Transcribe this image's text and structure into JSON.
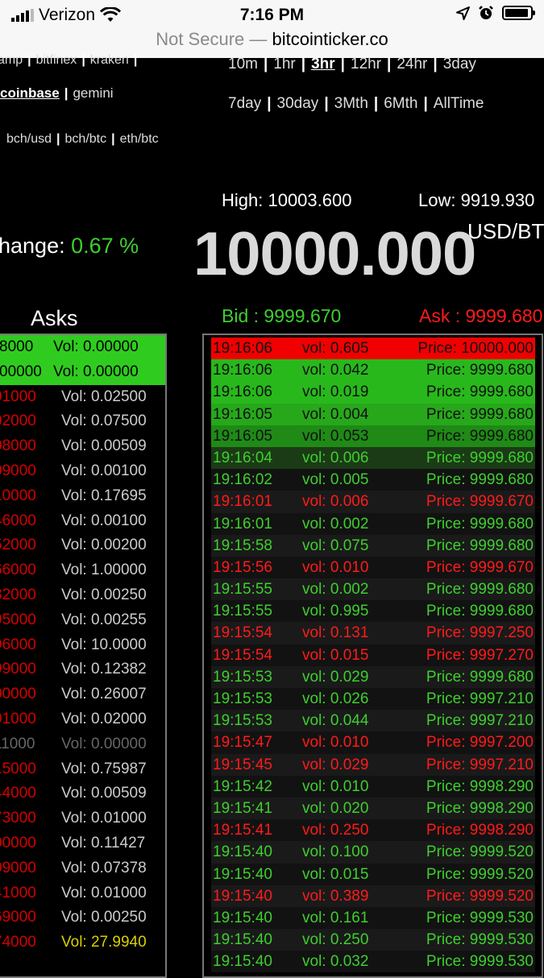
{
  "statusbar": {
    "carrier": "Verizon",
    "time": "7:16 PM"
  },
  "addressbar": {
    "security": "Not Secure —",
    "domain": "bitcointicker.co"
  },
  "exchanges": {
    "row1": [
      "amp",
      "bitfinex",
      "kraken"
    ],
    "row2": [
      "coinbase",
      "gemini"
    ],
    "selected": "coinbase"
  },
  "pairs": [
    "bch/usd",
    "bch/btc",
    "eth/btc"
  ],
  "ranges": {
    "row1": [
      "10m",
      "1hr",
      "3hr",
      "12hr",
      "24hr",
      "3day"
    ],
    "row2": [
      "7day",
      "30day",
      "3Mth",
      "6Mth",
      "AllTime"
    ],
    "selected": "3hr"
  },
  "ticker": {
    "high": "High: 10003.600",
    "low": "Low: 9919.930",
    "change_label": "hange:",
    "change_value": "0.67 %",
    "price": "10000.000",
    "unit": "USD/BT",
    "bid": "Bid  : 9999.670",
    "ask": "Ask : 9999.680"
  },
  "asks": {
    "title": "Asks",
    "rows": [
      {
        "price": "8000",
        "vol": "Vol: 0.00000",
        "style": "hl"
      },
      {
        "price": "00000",
        "vol": "Vol: 0.00000",
        "style": "hl"
      },
      {
        "price": "01000",
        "vol": "Vol: 0.02500",
        "style": "n"
      },
      {
        "price": "02000",
        "vol": "Vol: 0.07500",
        "style": "n"
      },
      {
        "price": "08000",
        "vol": "Vol: 0.00509",
        "style": "n"
      },
      {
        "price": "09000",
        "vol": "Vol: 0.00100",
        "style": "n"
      },
      {
        "price": "10000",
        "vol": "Vol: 0.17695",
        "style": "n"
      },
      {
        "price": "46000",
        "vol": "Vol: 0.00100",
        "style": "n"
      },
      {
        "price": "52000",
        "vol": "Vol: 0.00200",
        "style": "n"
      },
      {
        "price": "66000",
        "vol": "Vol: 1.00000",
        "style": "n"
      },
      {
        "price": "82000",
        "vol": "Vol: 0.00250",
        "style": "n"
      },
      {
        "price": "95000",
        "vol": "Vol: 0.00255",
        "style": "n"
      },
      {
        "price": "96000",
        "vol": "Vol: 10.0000",
        "style": "n"
      },
      {
        "price": "99000",
        "vol": "Vol: 0.12382",
        "style": "n"
      },
      {
        "price": "00000",
        "vol": "Vol: 0.26007",
        "style": "n"
      },
      {
        "price": "01000",
        "vol": "Vol: 0.02000",
        "style": "n"
      },
      {
        "price": "11000",
        "vol": "Vol: 0.00000",
        "style": "dim"
      },
      {
        "price": "15000",
        "vol": "Vol: 0.75987",
        "style": "n"
      },
      {
        "price": "44000",
        "vol": "Vol: 0.00509",
        "style": "n"
      },
      {
        "price": "73000",
        "vol": "Vol: 0.01000",
        "style": "n"
      },
      {
        "price": "00000",
        "vol": "Vol: 0.11427",
        "style": "n"
      },
      {
        "price": "09000",
        "vol": "Vol: 0.07378",
        "style": "n"
      },
      {
        "price": "41000",
        "vol": "Vol: 0.01000",
        "style": "n"
      },
      {
        "price": "69000",
        "vol": "Vol: 0.00250",
        "style": "n"
      },
      {
        "price": "74000",
        "vol": "Vol: 27.9940",
        "style": "big"
      }
    ]
  },
  "trades": [
    {
      "time": "19:16:06",
      "vol": "vol: 0.605",
      "price": "Price: 10000.000",
      "side": "sell",
      "flash": "#f00000"
    },
    {
      "time": "19:16:06",
      "vol": "vol: 0.042",
      "price": "Price: 9999.680",
      "side": "buy",
      "flash": "#28b81c"
    },
    {
      "time": "19:16:06",
      "vol": "vol: 0.019",
      "price": "Price: 9999.680",
      "side": "buy",
      "flash": "#28b81c"
    },
    {
      "time": "19:16:05",
      "vol": "vol: 0.004",
      "price": "Price: 9999.680",
      "side": "buy",
      "flash": "#27a81b"
    },
    {
      "time": "19:16:05",
      "vol": "vol: 0.053",
      "price": "Price: 9999.680",
      "side": "buy",
      "flash": "#1f8a16"
    },
    {
      "time": "19:16:04",
      "vol": "vol: 0.006",
      "price": "Price: 9999.680",
      "side": "buy",
      "flash": "#1b3b16"
    },
    {
      "time": "19:16:02",
      "vol": "vol: 0.005",
      "price": "Price: 9999.680",
      "side": "buy",
      "flash": "#121212"
    },
    {
      "time": "19:16:01",
      "vol": "vol: 0.006",
      "price": "Price: 9999.670",
      "side": "sell",
      "flash": "#1a1a1a"
    },
    {
      "time": "19:16:01",
      "vol": "vol: 0.002",
      "price": "Price: 9999.680",
      "side": "buy",
      "flash": "#121212"
    },
    {
      "time": "19:15:58",
      "vol": "vol: 0.075",
      "price": "Price: 9999.680",
      "side": "buy",
      "flash": "#1a1a1a"
    },
    {
      "time": "19:15:56",
      "vol": "vol: 0.010",
      "price": "Price: 9999.670",
      "side": "sell",
      "flash": "#121212"
    },
    {
      "time": "19:15:55",
      "vol": "vol: 0.002",
      "price": "Price: 9999.680",
      "side": "buy",
      "flash": "#1a1a1a"
    },
    {
      "time": "19:15:55",
      "vol": "vol: 0.995",
      "price": "Price: 9999.680",
      "side": "buy",
      "flash": "#121212"
    },
    {
      "time": "19:15:54",
      "vol": "vol: 0.131",
      "price": "Price: 9997.250",
      "side": "sell",
      "flash": "#1a1a1a"
    },
    {
      "time": "19:15:54",
      "vol": "vol: 0.015",
      "price": "Price: 9997.270",
      "side": "sell",
      "flash": "#121212"
    },
    {
      "time": "19:15:53",
      "vol": "vol: 0.029",
      "price": "Price: 9999.680",
      "side": "buy",
      "flash": "#1a1a1a"
    },
    {
      "time": "19:15:53",
      "vol": "vol: 0.026",
      "price": "Price: 9997.210",
      "side": "buy",
      "flash": "#121212"
    },
    {
      "time": "19:15:53",
      "vol": "vol: 0.044",
      "price": "Price: 9997.210",
      "side": "buy",
      "flash": "#1a1a1a"
    },
    {
      "time": "19:15:47",
      "vol": "vol: 0.010",
      "price": "Price: 9997.200",
      "side": "sell",
      "flash": "#121212"
    },
    {
      "time": "19:15:45",
      "vol": "vol: 0.029",
      "price": "Price: 9997.210",
      "side": "sell",
      "flash": "#1a1a1a"
    },
    {
      "time": "19:15:42",
      "vol": "vol: 0.010",
      "price": "Price: 9998.290",
      "side": "buy",
      "flash": "#121212"
    },
    {
      "time": "19:15:41",
      "vol": "vol: 0.020",
      "price": "Price: 9998.290",
      "side": "buy",
      "flash": "#1a1a1a"
    },
    {
      "time": "19:15:41",
      "vol": "vol: 0.250",
      "price": "Price: 9998.290",
      "side": "sell",
      "flash": "#121212"
    },
    {
      "time": "19:15:40",
      "vol": "vol: 0.100",
      "price": "Price: 9999.520",
      "side": "buy",
      "flash": "#1a1a1a"
    },
    {
      "time": "19:15:40",
      "vol": "vol: 0.015",
      "price": "Price: 9999.520",
      "side": "buy",
      "flash": "#121212"
    },
    {
      "time": "19:15:40",
      "vol": "vol: 0.389",
      "price": "Price: 9999.520",
      "side": "sell",
      "flash": "#1a1a1a"
    },
    {
      "time": "19:15:40",
      "vol": "vol: 0.161",
      "price": "Price: 9999.530",
      "side": "buy",
      "flash": "#121212"
    },
    {
      "time": "19:15:40",
      "vol": "vol: 0.250",
      "price": "Price: 9999.530",
      "side": "buy",
      "flash": "#1a1a1a"
    },
    {
      "time": "19:15:40",
      "vol": "vol: 0.032",
      "price": "Price: 9999.530",
      "side": "buy",
      "flash": "#121212"
    }
  ],
  "colors": {
    "buy": "#3ecf2e",
    "sell": "#ff1a1a",
    "flash_text": "#111111",
    "ask_price": "#d40000",
    "ask_vol": "#cccccc",
    "ask_dim": "#666666",
    "ask_big": "#d8d000"
  },
  "icons": [
    "signal-bars-icon",
    "wifi-icon",
    "location-arrow-icon",
    "alarm-clock-icon",
    "battery-icon"
  ]
}
